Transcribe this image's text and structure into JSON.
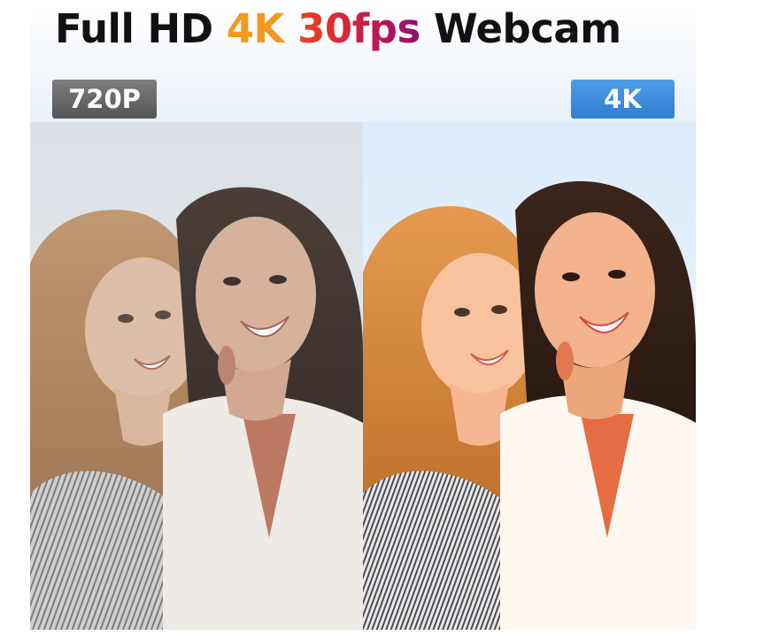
{
  "header": {
    "title_parts": [
      "Full HD",
      "4K",
      "30fps",
      "Webcam"
    ]
  },
  "badges": {
    "left_label": "720P",
    "right_label": "4K"
  },
  "colors": {
    "title_text": "#111111",
    "title_4k": "#f39a1e",
    "title_30fps_gradient": [
      "#e8461e",
      "#8e0f6e"
    ],
    "badge_left_bg": "#666666",
    "badge_right_bg": "#3a88d8",
    "badge_text": "#ffffff"
  },
  "images": {
    "left": "comparison-photo-720p",
    "right": "comparison-photo-4k"
  }
}
